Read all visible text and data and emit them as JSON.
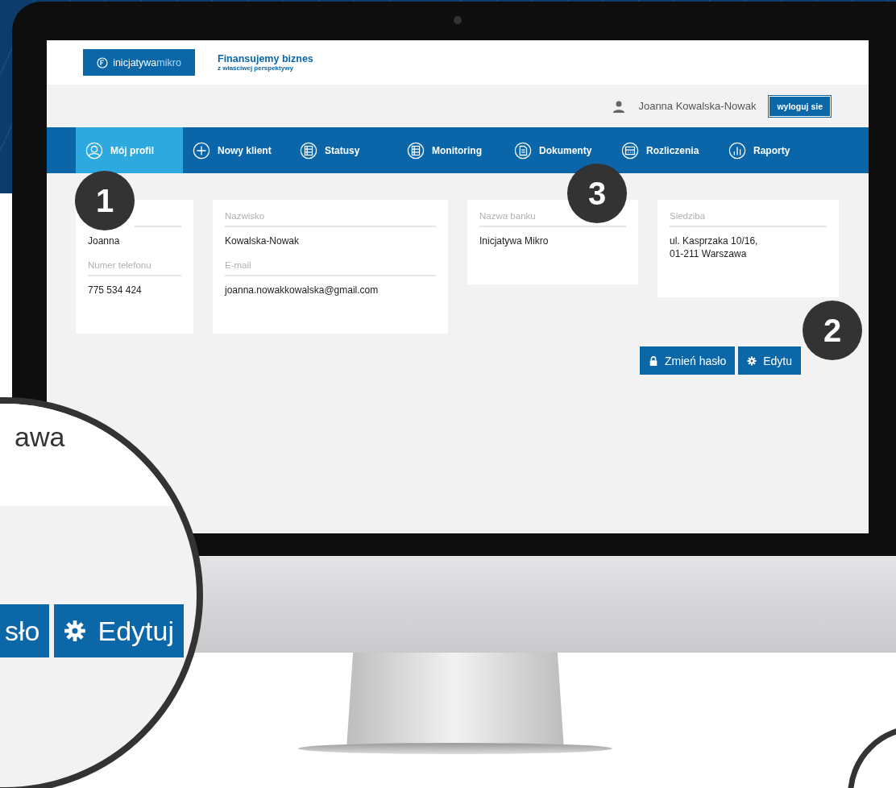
{
  "logo": {
    "name": "inicjatywa",
    "suffix": "mikro"
  },
  "tagline": {
    "title": "Finansujemy biznes",
    "subtitle": "z właściwej perspektywy"
  },
  "user": {
    "name": "Joanna Kowalska-Nowak",
    "logout": "wyloguj sie"
  },
  "nav": [
    {
      "label": "Mój profil",
      "selected": true
    },
    {
      "label": "Nowy klient",
      "selected": false
    },
    {
      "label": "Statusy",
      "selected": false
    },
    {
      "label": "Monitoring",
      "selected": false
    },
    {
      "label": "Dokumenty",
      "selected": false
    },
    {
      "label": "Rozliczenia",
      "selected": false
    },
    {
      "label": "Raporty",
      "selected": false
    }
  ],
  "cards": [
    {
      "fields": [
        {
          "value": "Joanna"
        },
        {
          "label": "Numer telefonu",
          "value": "775 534 424"
        }
      ]
    },
    {
      "fields": [
        {
          "label": "Nazwisko",
          "value": "Kowalska-Nowak"
        },
        {
          "label": "E-mail",
          "value": "joanna.nowakkowalska@gmail.com"
        }
      ]
    },
    {
      "fields": [
        {
          "label": "Nazwa banku",
          "value": "Inicjatywa Mikro"
        }
      ]
    },
    {
      "fields": [
        {
          "label": "Siedziba",
          "value": "ul. Kasprzaka 10/16,\n01-211 Warszawa"
        }
      ]
    }
  ],
  "actions": [
    {
      "label": "Zmień hasło"
    },
    {
      "label": "Edytu"
    }
  ],
  "callouts": [
    "1",
    "2",
    "3"
  ],
  "magnifier": {
    "address_fragment": "awa",
    "button_fragment": "sło",
    "button": "Edytuj"
  }
}
